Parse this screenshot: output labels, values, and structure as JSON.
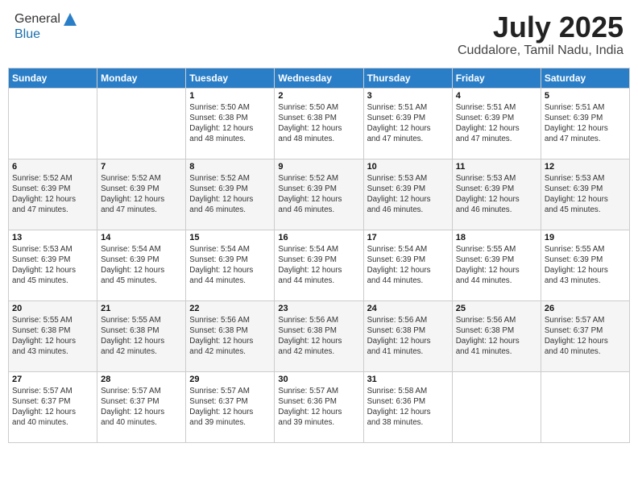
{
  "header": {
    "logo_line1": "General",
    "logo_line2": "Blue",
    "month_year": "July 2025",
    "location": "Cuddalore, Tamil Nadu, India"
  },
  "weekdays": [
    "Sunday",
    "Monday",
    "Tuesday",
    "Wednesday",
    "Thursday",
    "Friday",
    "Saturday"
  ],
  "weeks": [
    [
      {
        "day": "",
        "info": ""
      },
      {
        "day": "",
        "info": ""
      },
      {
        "day": "1",
        "info": "Sunrise: 5:50 AM\nSunset: 6:38 PM\nDaylight: 12 hours\nand 48 minutes."
      },
      {
        "day": "2",
        "info": "Sunrise: 5:50 AM\nSunset: 6:38 PM\nDaylight: 12 hours\nand 48 minutes."
      },
      {
        "day": "3",
        "info": "Sunrise: 5:51 AM\nSunset: 6:39 PM\nDaylight: 12 hours\nand 47 minutes."
      },
      {
        "day": "4",
        "info": "Sunrise: 5:51 AM\nSunset: 6:39 PM\nDaylight: 12 hours\nand 47 minutes."
      },
      {
        "day": "5",
        "info": "Sunrise: 5:51 AM\nSunset: 6:39 PM\nDaylight: 12 hours\nand 47 minutes."
      }
    ],
    [
      {
        "day": "6",
        "info": "Sunrise: 5:52 AM\nSunset: 6:39 PM\nDaylight: 12 hours\nand 47 minutes."
      },
      {
        "day": "7",
        "info": "Sunrise: 5:52 AM\nSunset: 6:39 PM\nDaylight: 12 hours\nand 47 minutes."
      },
      {
        "day": "8",
        "info": "Sunrise: 5:52 AM\nSunset: 6:39 PM\nDaylight: 12 hours\nand 46 minutes."
      },
      {
        "day": "9",
        "info": "Sunrise: 5:52 AM\nSunset: 6:39 PM\nDaylight: 12 hours\nand 46 minutes."
      },
      {
        "day": "10",
        "info": "Sunrise: 5:53 AM\nSunset: 6:39 PM\nDaylight: 12 hours\nand 46 minutes."
      },
      {
        "day": "11",
        "info": "Sunrise: 5:53 AM\nSunset: 6:39 PM\nDaylight: 12 hours\nand 46 minutes."
      },
      {
        "day": "12",
        "info": "Sunrise: 5:53 AM\nSunset: 6:39 PM\nDaylight: 12 hours\nand 45 minutes."
      }
    ],
    [
      {
        "day": "13",
        "info": "Sunrise: 5:53 AM\nSunset: 6:39 PM\nDaylight: 12 hours\nand 45 minutes."
      },
      {
        "day": "14",
        "info": "Sunrise: 5:54 AM\nSunset: 6:39 PM\nDaylight: 12 hours\nand 45 minutes."
      },
      {
        "day": "15",
        "info": "Sunrise: 5:54 AM\nSunset: 6:39 PM\nDaylight: 12 hours\nand 44 minutes."
      },
      {
        "day": "16",
        "info": "Sunrise: 5:54 AM\nSunset: 6:39 PM\nDaylight: 12 hours\nand 44 minutes."
      },
      {
        "day": "17",
        "info": "Sunrise: 5:54 AM\nSunset: 6:39 PM\nDaylight: 12 hours\nand 44 minutes."
      },
      {
        "day": "18",
        "info": "Sunrise: 5:55 AM\nSunset: 6:39 PM\nDaylight: 12 hours\nand 44 minutes."
      },
      {
        "day": "19",
        "info": "Sunrise: 5:55 AM\nSunset: 6:39 PM\nDaylight: 12 hours\nand 43 minutes."
      }
    ],
    [
      {
        "day": "20",
        "info": "Sunrise: 5:55 AM\nSunset: 6:38 PM\nDaylight: 12 hours\nand 43 minutes."
      },
      {
        "day": "21",
        "info": "Sunrise: 5:55 AM\nSunset: 6:38 PM\nDaylight: 12 hours\nand 42 minutes."
      },
      {
        "day": "22",
        "info": "Sunrise: 5:56 AM\nSunset: 6:38 PM\nDaylight: 12 hours\nand 42 minutes."
      },
      {
        "day": "23",
        "info": "Sunrise: 5:56 AM\nSunset: 6:38 PM\nDaylight: 12 hours\nand 42 minutes."
      },
      {
        "day": "24",
        "info": "Sunrise: 5:56 AM\nSunset: 6:38 PM\nDaylight: 12 hours\nand 41 minutes."
      },
      {
        "day": "25",
        "info": "Sunrise: 5:56 AM\nSunset: 6:38 PM\nDaylight: 12 hours\nand 41 minutes."
      },
      {
        "day": "26",
        "info": "Sunrise: 5:57 AM\nSunset: 6:37 PM\nDaylight: 12 hours\nand 40 minutes."
      }
    ],
    [
      {
        "day": "27",
        "info": "Sunrise: 5:57 AM\nSunset: 6:37 PM\nDaylight: 12 hours\nand 40 minutes."
      },
      {
        "day": "28",
        "info": "Sunrise: 5:57 AM\nSunset: 6:37 PM\nDaylight: 12 hours\nand 40 minutes."
      },
      {
        "day": "29",
        "info": "Sunrise: 5:57 AM\nSunset: 6:37 PM\nDaylight: 12 hours\nand 39 minutes."
      },
      {
        "day": "30",
        "info": "Sunrise: 5:57 AM\nSunset: 6:36 PM\nDaylight: 12 hours\nand 39 minutes."
      },
      {
        "day": "31",
        "info": "Sunrise: 5:58 AM\nSunset: 6:36 PM\nDaylight: 12 hours\nand 38 minutes."
      },
      {
        "day": "",
        "info": ""
      },
      {
        "day": "",
        "info": ""
      }
    ]
  ]
}
